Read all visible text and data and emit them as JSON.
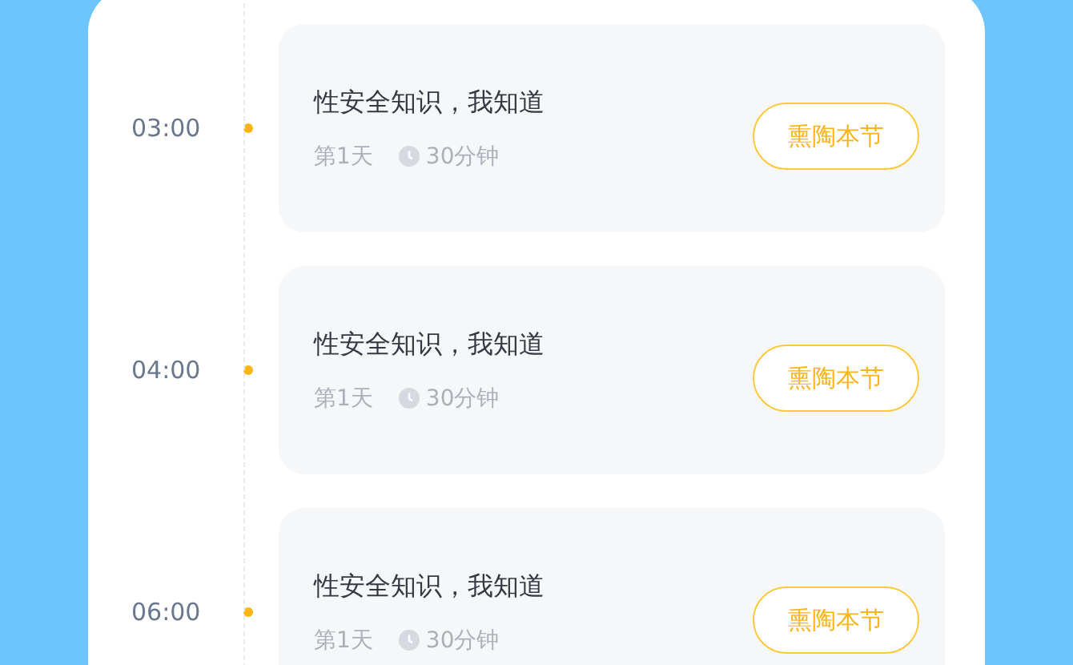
{
  "sessions": [
    {
      "time": "03:00",
      "title": "性安全知识，我知道",
      "day": "第1天",
      "duration": "30分钟",
      "action": "熏陶本节"
    },
    {
      "time": "04:00",
      "title": "性安全知识，我知道",
      "day": "第1天",
      "duration": "30分钟",
      "action": "熏陶本节"
    },
    {
      "time": "06:00",
      "title": "性安全知识，我知道",
      "day": "第1天",
      "duration": "30分钟",
      "action": "熏陶本节"
    }
  ]
}
